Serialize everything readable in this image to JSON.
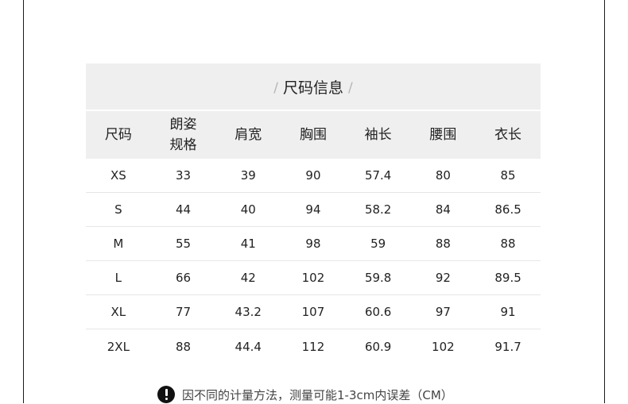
{
  "title": "尺码信息",
  "headers": [
    "尺码",
    "朗姿\n规格",
    "肩宽",
    "胸围",
    "袖长",
    "腰围",
    "衣长"
  ],
  "rows": [
    [
      "XS",
      "33",
      "39",
      "90",
      "57.4",
      "80",
      "85"
    ],
    [
      "S",
      "44",
      "40",
      "94",
      "58.2",
      "84",
      "86.5"
    ],
    [
      "M",
      "55",
      "41",
      "98",
      "59",
      "88",
      "88"
    ],
    [
      "L",
      "66",
      "42",
      "102",
      "59.8",
      "92",
      "89.5"
    ],
    [
      "XL",
      "77",
      "43.2",
      "107",
      "60.6",
      "97",
      "91"
    ],
    [
      "2XL",
      "88",
      "44.4",
      "112",
      "60.9",
      "102",
      "91.7"
    ]
  ],
  "note": "因不同的计量方法，测量可能1-3cm内误差（CM）",
  "note_icon": "exclamation-circle-icon"
}
